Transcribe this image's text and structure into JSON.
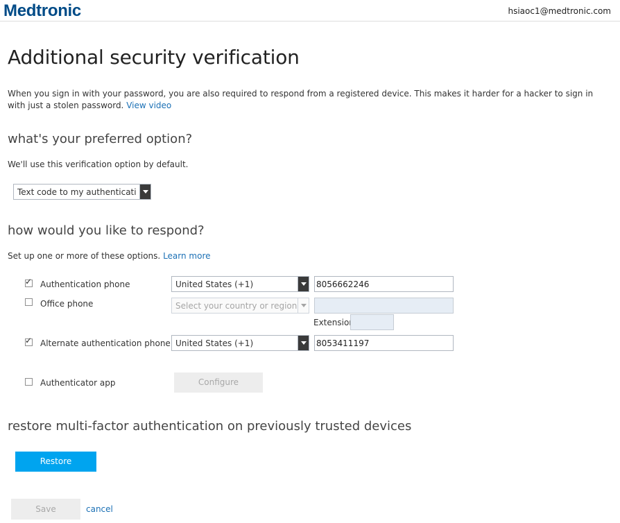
{
  "header": {
    "logo_text": "Medtronic",
    "user_email": "hsiaoc1@medtronic.com"
  },
  "page": {
    "title": "Additional security verification",
    "description": "When you sign in with your password, you are also required to respond from a registered device. This makes it harder for a hacker to sign in with just a stolen password.",
    "view_video_link": "View video"
  },
  "preferred": {
    "heading": "what's your preferred option?",
    "subtext": "We'll use this verification option by default.",
    "selected_option": "Text code to my authentication phone"
  },
  "respond": {
    "heading": "how would you like to respond?",
    "subtext": "Set up one or more of these options.",
    "learn_more_link": "Learn more",
    "options": [
      {
        "label": "Authentication phone",
        "checked": true,
        "country": "United States (+1)",
        "phone": "8056662246"
      },
      {
        "label": "Office phone",
        "checked": false,
        "country_placeholder": "Select your country or region",
        "phone": "",
        "extension_label": "Extension",
        "extension": ""
      },
      {
        "label": "Alternate authentication phone",
        "checked": true,
        "country": "United States (+1)",
        "phone": "8053411197"
      },
      {
        "label": "Authenticator app",
        "checked": false,
        "button_label": "Configure"
      }
    ]
  },
  "restore": {
    "heading": "restore multi-factor authentication on previously trusted devices",
    "button_label": "Restore"
  },
  "footer": {
    "save_label": "Save",
    "cancel_label": "cancel"
  },
  "colors": {
    "brand": "#004b87",
    "link": "#1b70b5",
    "primary_button": "#00a4ef"
  }
}
